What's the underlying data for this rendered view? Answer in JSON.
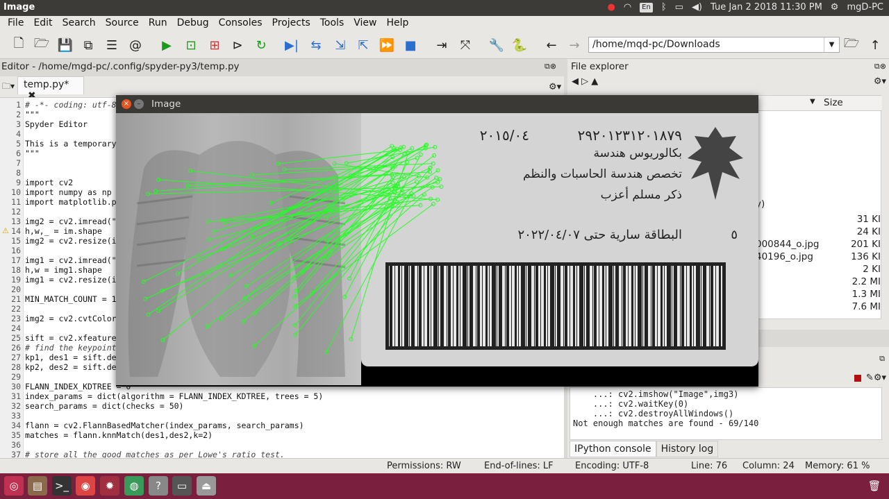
{
  "topbar": {
    "app_title": "Image",
    "keyboard": "En",
    "datetime": "Tue Jan  2 2018 11:30 PM",
    "user": "mgD-PC"
  },
  "menubar": {
    "items": [
      "File",
      "Edit",
      "Search",
      "Source",
      "Run",
      "Debug",
      "Consoles",
      "Projects",
      "Tools",
      "View",
      "Help"
    ]
  },
  "toolbar": {
    "path": "/home/mqd-pc/Downloads"
  },
  "editor": {
    "title": "Editor - /home/mgd-pc/.config/spyder-py3/temp.py",
    "tab_label": "temp.py*",
    "tab_close": "✖",
    "lines": [
      {
        "n": "1",
        "text": "# -*- coding: utf-8",
        "cmt": true
      },
      {
        "n": "2",
        "text": "\"\"\""
      },
      {
        "n": "3",
        "text": "Spyder Editor"
      },
      {
        "n": "4",
        "text": ""
      },
      {
        "n": "5",
        "text": "This is a temporary"
      },
      {
        "n": "6",
        "text": "\"\"\""
      },
      {
        "n": "7",
        "text": ""
      },
      {
        "n": "8",
        "text": ""
      },
      {
        "n": "9",
        "text": "import cv2"
      },
      {
        "n": "10",
        "text": "import numpy as np"
      },
      {
        "n": "11",
        "text": "import matplotlib.p"
      },
      {
        "n": "12",
        "text": ""
      },
      {
        "n": "13",
        "text": "img2 = cv2.imread(\""
      },
      {
        "n": "14",
        "text": "h,w,_ = im.shape"
      },
      {
        "n": "15",
        "text": "img2 = cv2.resize(i"
      },
      {
        "n": "16",
        "text": ""
      },
      {
        "n": "17",
        "text": "img1 = cv2.imread(\""
      },
      {
        "n": "18",
        "text": "h,w = img1.shape"
      },
      {
        "n": "19",
        "text": "img1 = cv2.resize(i"
      },
      {
        "n": "20",
        "text": ""
      },
      {
        "n": "21",
        "text": "MIN_MATCH_COUNT = 1"
      },
      {
        "n": "22",
        "text": ""
      },
      {
        "n": "23",
        "text": "img2 = cv2.cvtColor"
      },
      {
        "n": "24",
        "text": ""
      },
      {
        "n": "25",
        "text": "sift = cv2.xfeature"
      },
      {
        "n": "26",
        "text": "# find the keypoint",
        "cmt": true
      },
      {
        "n": "27",
        "text": "kp1, des1 = sift.de"
      },
      {
        "n": "28",
        "text": "kp2, des2 = sift.de"
      },
      {
        "n": "29",
        "text": ""
      },
      {
        "n": "30",
        "text": "FLANN_INDEX_KDTREE = 0"
      },
      {
        "n": "31",
        "text": "index_params = dict(algorithm = FLANN_INDEX_KDTREE, trees = 5)"
      },
      {
        "n": "32",
        "text": "search_params = dict(checks = 50)"
      },
      {
        "n": "33",
        "text": ""
      },
      {
        "n": "34",
        "text": "flann = cv2.FlannBasedMatcher(index_params, search_params)"
      },
      {
        "n": "35",
        "text": "matches = flann.knnMatch(des1,des2,k=2)"
      },
      {
        "n": "36",
        "text": ""
      },
      {
        "n": "37",
        "text": "# store all the good matches as per Lowe's ratio test.",
        "cmt": true
      }
    ]
  },
  "file_explorer": {
    "title": "File explorer",
    "size_header": "Size",
    "sort_arrow": "▼",
    "rows": [
      {
        "name": "y)",
        "size": ""
      },
      {
        "name": "",
        "size": "31 KI"
      },
      {
        "name": "",
        "size": "24 KI"
      },
      {
        "name": "000844_o.jpg",
        "size": "201 KI"
      },
      {
        "name": "40196_o.jpg",
        "size": "136 KI"
      },
      {
        "name": "",
        "size": "2 KI"
      },
      {
        "name": "",
        "size": "2.2 MI"
      },
      {
        "name": "",
        "size": "1.3 MI"
      },
      {
        "name": "",
        "size": "7.6 MI"
      }
    ]
  },
  "console": {
    "lines": [
      "    ...: cv2.imshow(\"Image\",img3)",
      "    ...: cv2.waitKey(0)",
      "    ...: cv2.destroyAllWindows()",
      "Not enough matches are found - 69/140"
    ],
    "tabs": [
      "IPython console",
      "History log"
    ]
  },
  "statusbar": {
    "permissions": "Permissions: RW",
    "eol": "End-of-lines: LF",
    "encoding": "Encoding: UTF-8",
    "line": "Line: 76",
    "column": "Column: 24",
    "memory": "Memory: 61 %"
  },
  "image_window": {
    "title": "Image",
    "card_text": {
      "date": "٢٠١٥/٠٤",
      "id_number": "٢٩٢٠١٢٣١٢٠١٨٧٩",
      "degree": "بكالوريوس هندسة",
      "specialty": "تخصص هندسة الحاسبات والنظم",
      "gender_religion": "ذكر مسلم أعزب",
      "validity": "البطاقة سارية حتى ٢٠٢٢/٠٤/٠٧",
      "digit": "٥"
    },
    "match_line_color": "#22ff22"
  },
  "dock": {
    "apps": [
      "ubuntu-logo-icon",
      "files-icon",
      "terminal-icon",
      "chrome-icon",
      "spyder-icon",
      "app-icon",
      "help-icon",
      "window-icon",
      "drive-icon",
      "trash-icon"
    ]
  }
}
